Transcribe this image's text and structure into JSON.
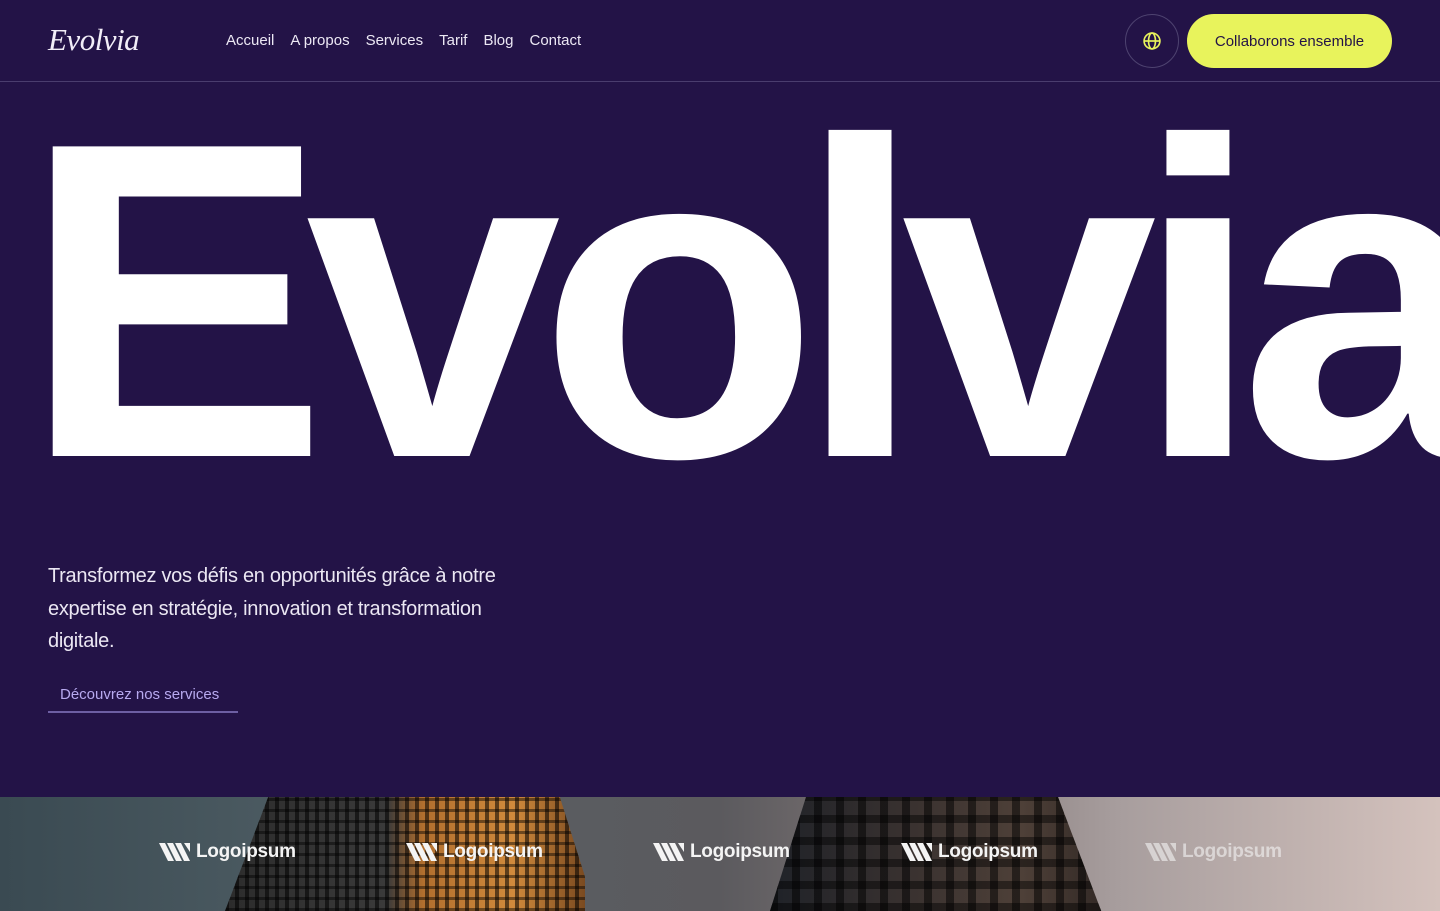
{
  "header": {
    "logo": "Evolvia",
    "nav": [
      {
        "label": "Accueil"
      },
      {
        "label": "A propos"
      },
      {
        "label": "Services"
      },
      {
        "label": "Tarif"
      },
      {
        "label": "Blog"
      },
      {
        "label": "Contact"
      }
    ],
    "language_icon": "globe-icon",
    "cta_label": "Collaborons ensemble"
  },
  "hero": {
    "title": "Evolvia.",
    "description": "Transformez vos défis en opportunités grâce à notre expertise en stratégie, innovation et transformation digitale.",
    "link_label": "Découvrez nos services"
  },
  "partners": {
    "logos": [
      {
        "name": "Logoipsum"
      },
      {
        "name": "Logoipsum"
      },
      {
        "name": "Logoipsum"
      },
      {
        "name": "Logoipsum"
      },
      {
        "name": "Logoipsum"
      }
    ]
  },
  "colors": {
    "background": "#231347",
    "accent": "#e8f35c",
    "link": "#b7a9ef",
    "text": "#ffffff"
  }
}
